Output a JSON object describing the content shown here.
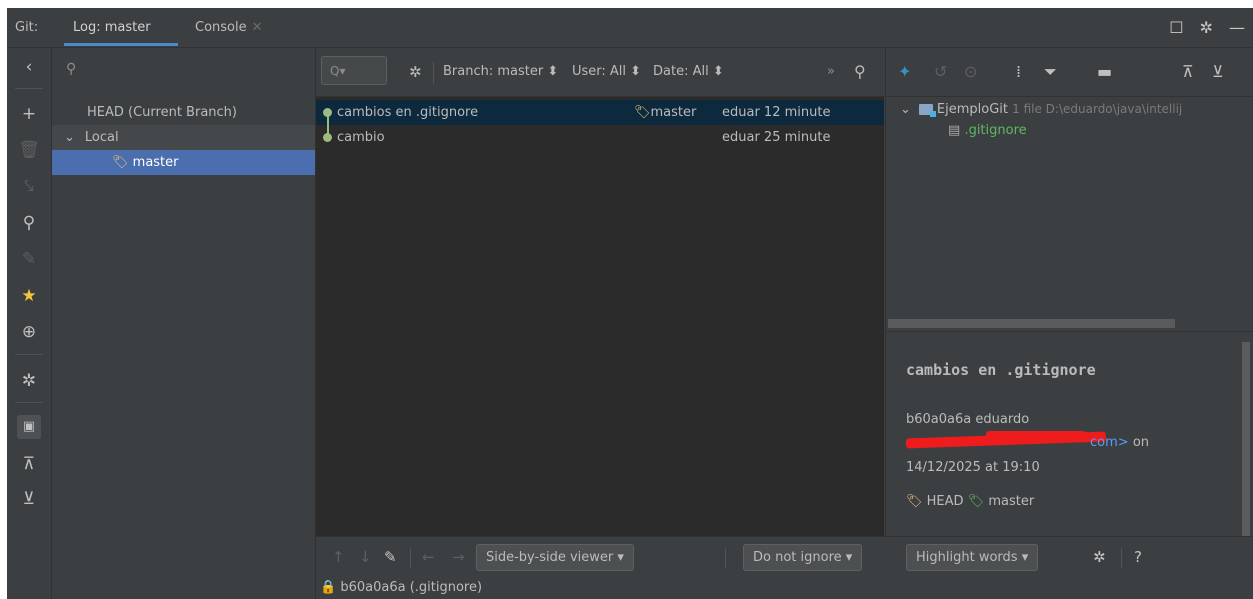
{
  "tabbar": {
    "git_label": "Git:",
    "tabs": [
      {
        "label": "Log: master"
      },
      {
        "label": "Console"
      }
    ]
  },
  "branches": {
    "items": [
      {
        "label": "HEAD (Current Branch)"
      },
      {
        "label": "Local"
      },
      {
        "label": "master"
      }
    ]
  },
  "log_toolbar": {
    "filter_placeholder": "Q",
    "branch_filter": "Branch: master",
    "user_filter": "User: All",
    "date_filter": "Date: All"
  },
  "commits": [
    {
      "subject": "cambios en .gitignore",
      "refs": "master",
      "author_time": "eduar 12 minute"
    },
    {
      "subject": "cambio",
      "refs": "",
      "author_time": "eduar 25 minute"
    }
  ],
  "changes_tree": {
    "root_label": "EjemploGit",
    "root_meta": "1 file D:\\eduardo\\java\\intellij",
    "file": ".gitignore"
  },
  "details": {
    "subject": "cambios en .gitignore",
    "hash_author": "b60a0a6a eduardo",
    "email_tail": "com>",
    "on": "on",
    "date": "14/12/2025 at 19:10",
    "ref_head": "HEAD",
    "ref_master": "master"
  },
  "diff_toolbar": {
    "viewer": "Side-by-side viewer",
    "ignore": "Do not ignore",
    "highlight": "Highlight words",
    "help": "?"
  },
  "status": {
    "text": "b60a0a6a (.gitignore)"
  },
  "colors": {
    "accent": "#4a88c7",
    "selection": "#4b6eaf",
    "graph": "#9bbb7f",
    "tag_yellow": "#e5c07b",
    "tag_green": "#5fb761"
  }
}
